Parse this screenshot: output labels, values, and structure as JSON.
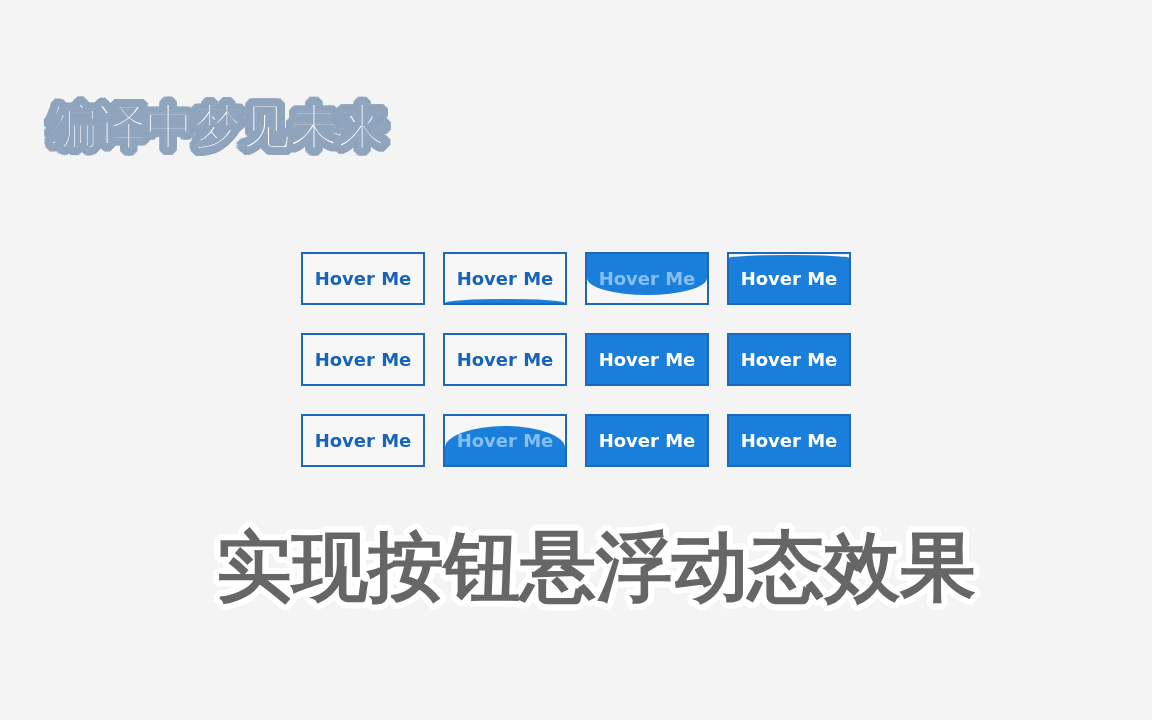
{
  "channel_name": "编译中梦见未来",
  "buttons": [
    {
      "label": "Hover Me",
      "kind": "outline"
    },
    {
      "label": "Hover Me",
      "kind": "sliver"
    },
    {
      "label": "Hover Me",
      "kind": "drip"
    },
    {
      "label": "Hover Me",
      "kind": "brim"
    },
    {
      "label": "Hover Me",
      "kind": "outline"
    },
    {
      "label": "Hover Me",
      "kind": "outline"
    },
    {
      "label": "Hover Me",
      "kind": "filled"
    },
    {
      "label": "Hover Me",
      "kind": "filled"
    },
    {
      "label": "Hover Me",
      "kind": "outline"
    },
    {
      "label": "Hover Me",
      "kind": "dome"
    },
    {
      "label": "Hover Me",
      "kind": "filled"
    },
    {
      "label": "Hover Me",
      "kind": "filled"
    }
  ],
  "headline": "实现按钮悬浮动态效果"
}
